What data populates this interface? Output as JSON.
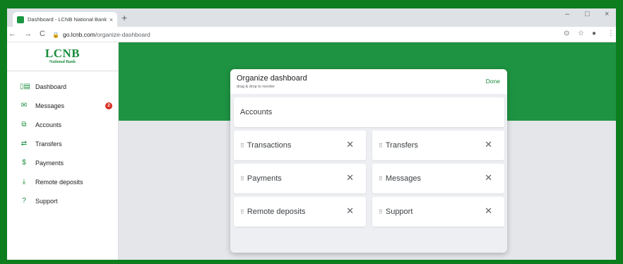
{
  "browser": {
    "tab_title": "Dashboard - LCNB National Bank",
    "tab_close": "×",
    "new_tab": "+",
    "url_host": "go.lcnb.com",
    "url_path": "/organize-dashboard",
    "controls": {
      "minimize": "–",
      "maximize": "□",
      "close": "×"
    },
    "nav": {
      "back": "←",
      "forward": "→",
      "reload": "C"
    },
    "icons": {
      "lock": "🔒",
      "target": "⊙",
      "star": "☆",
      "profile": "●",
      "menu": "⋮"
    }
  },
  "sidebar": {
    "logo_main": "LCNB",
    "logo_sub": "National Bank",
    "items": [
      {
        "label": "Dashboard",
        "icon": "▯▤"
      },
      {
        "label": "Messages",
        "icon": "✉",
        "badge": "2"
      },
      {
        "label": "Accounts",
        "icon": "⧉"
      },
      {
        "label": "Transfers",
        "icon": "⇄"
      },
      {
        "label": "Payments",
        "icon": "$"
      },
      {
        "label": "Remote deposits",
        "icon": "⤓"
      },
      {
        "label": "Support",
        "icon": "?"
      }
    ]
  },
  "modal": {
    "title": "Organize dashboard",
    "subtitle": "drag & drop to reorder",
    "done_label": "Done",
    "full_tile": "Accounts",
    "tiles": [
      "Transactions",
      "Transfers",
      "Payments",
      "Messages",
      "Remote deposits",
      "Support"
    ],
    "grip": "⠿",
    "remove": "✕"
  },
  "colors": {
    "brand_green": "#1a8c3c",
    "hero_green": "#1e9342",
    "badge_red": "#d93025"
  }
}
